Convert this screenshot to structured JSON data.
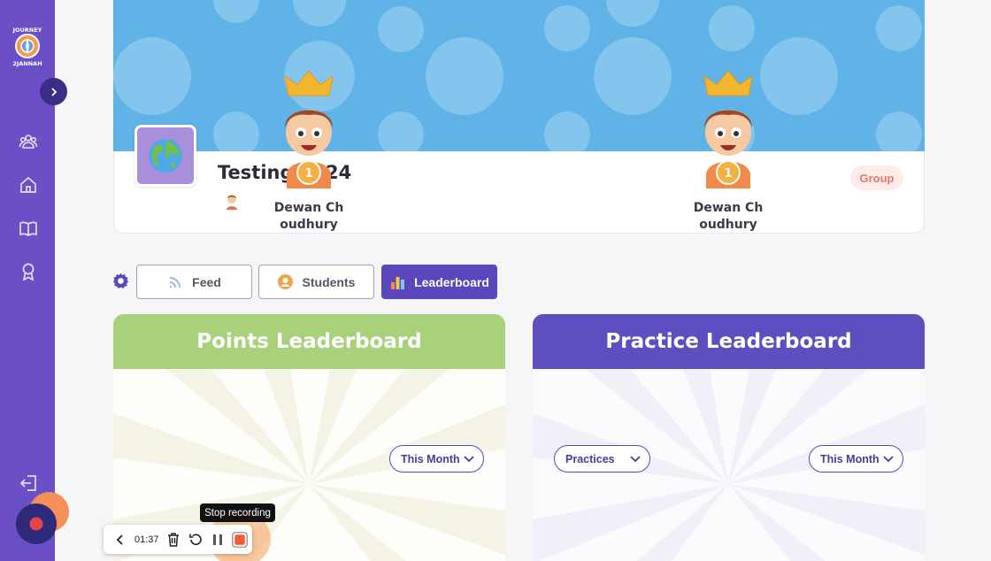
{
  "sidebar": {
    "logo_alt": "Journey 2 Jannah",
    "nav": [
      {
        "icon": "users-icon"
      },
      {
        "icon": "home-icon"
      },
      {
        "icon": "book-icon"
      },
      {
        "icon": "award-icon"
      }
    ],
    "expand_icon": "chevron-right-icon",
    "logout_icon": "logout-icon"
  },
  "group": {
    "title": "Testing 2024",
    "badge": "Group",
    "avatar_icon": "globe-icon"
  },
  "tabs": [
    {
      "label": "Feed",
      "icon": "rss-icon",
      "active": false
    },
    {
      "label": "Students",
      "icon": "student-icon",
      "active": false
    },
    {
      "label": "Leaderboard",
      "icon": "bar-chart-icon",
      "active": true
    }
  ],
  "points_leaderboard": {
    "title": "Points Leaderboard",
    "period": "This Month",
    "winner_name_line1": "Dewan Ch",
    "winner_name_line2": "oudhury",
    "rank": "1"
  },
  "practice_leaderboard": {
    "title": "Practice Leaderboard",
    "filter": "Practices",
    "period": "This Month",
    "winner_name_line1": "Dewan Ch",
    "winner_name_line2": "oudhury",
    "rank": "1"
  },
  "recording": {
    "time": "01:37",
    "tooltip": "Stop recording"
  },
  "colors": {
    "sidebar": "#6b4fc6",
    "cover": "#5fb3e6",
    "points_header": "#a9d17a",
    "practice_header": "#5e4fc0",
    "active_tab": "#5b46bd"
  }
}
